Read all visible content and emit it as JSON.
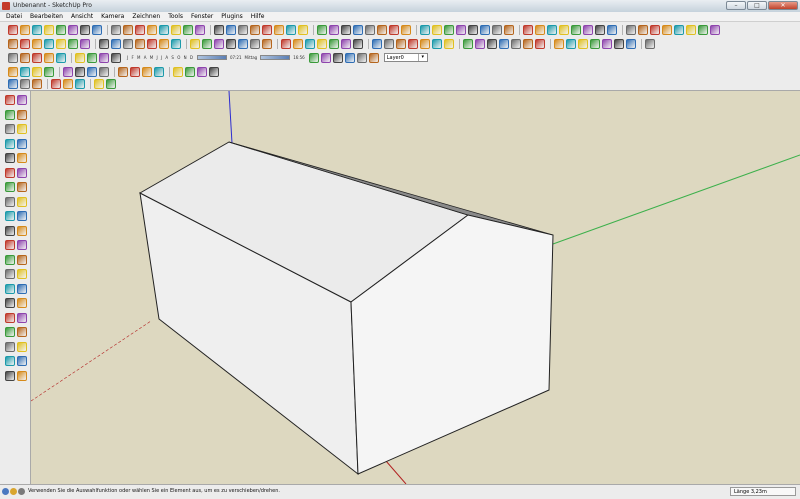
{
  "window": {
    "title": "Unbenannt - SketchUp Pro",
    "minimize": "–",
    "maximize": "□",
    "close": "✕"
  },
  "menu": [
    "Datei",
    "Bearbeiten",
    "Ansicht",
    "Kamera",
    "Zeichnen",
    "Tools",
    "Fenster",
    "Plugins",
    "Hilfe"
  ],
  "shadow": {
    "months": "J F M A M J J A S O N D",
    "time_start": "07:21",
    "time_mid": "Mittag",
    "time_end": "16:56"
  },
  "layer": {
    "selected": "Layer0"
  },
  "status": {
    "message": "Verwenden Sie die Auswahlfunktion oder wählen Sie ein Element aus, um es zu verschieben/drehen.",
    "measurement": "Länge 3,23m"
  },
  "colors": {
    "sky": "#dcdcdc",
    "ground": "#ddd8c0",
    "face": "#f2f2f2",
    "roof_shadow": "#8a8a8a",
    "axis_red": "#b22222",
    "axis_green": "#3cb04b",
    "axis_blue": "#2d2dd0"
  }
}
